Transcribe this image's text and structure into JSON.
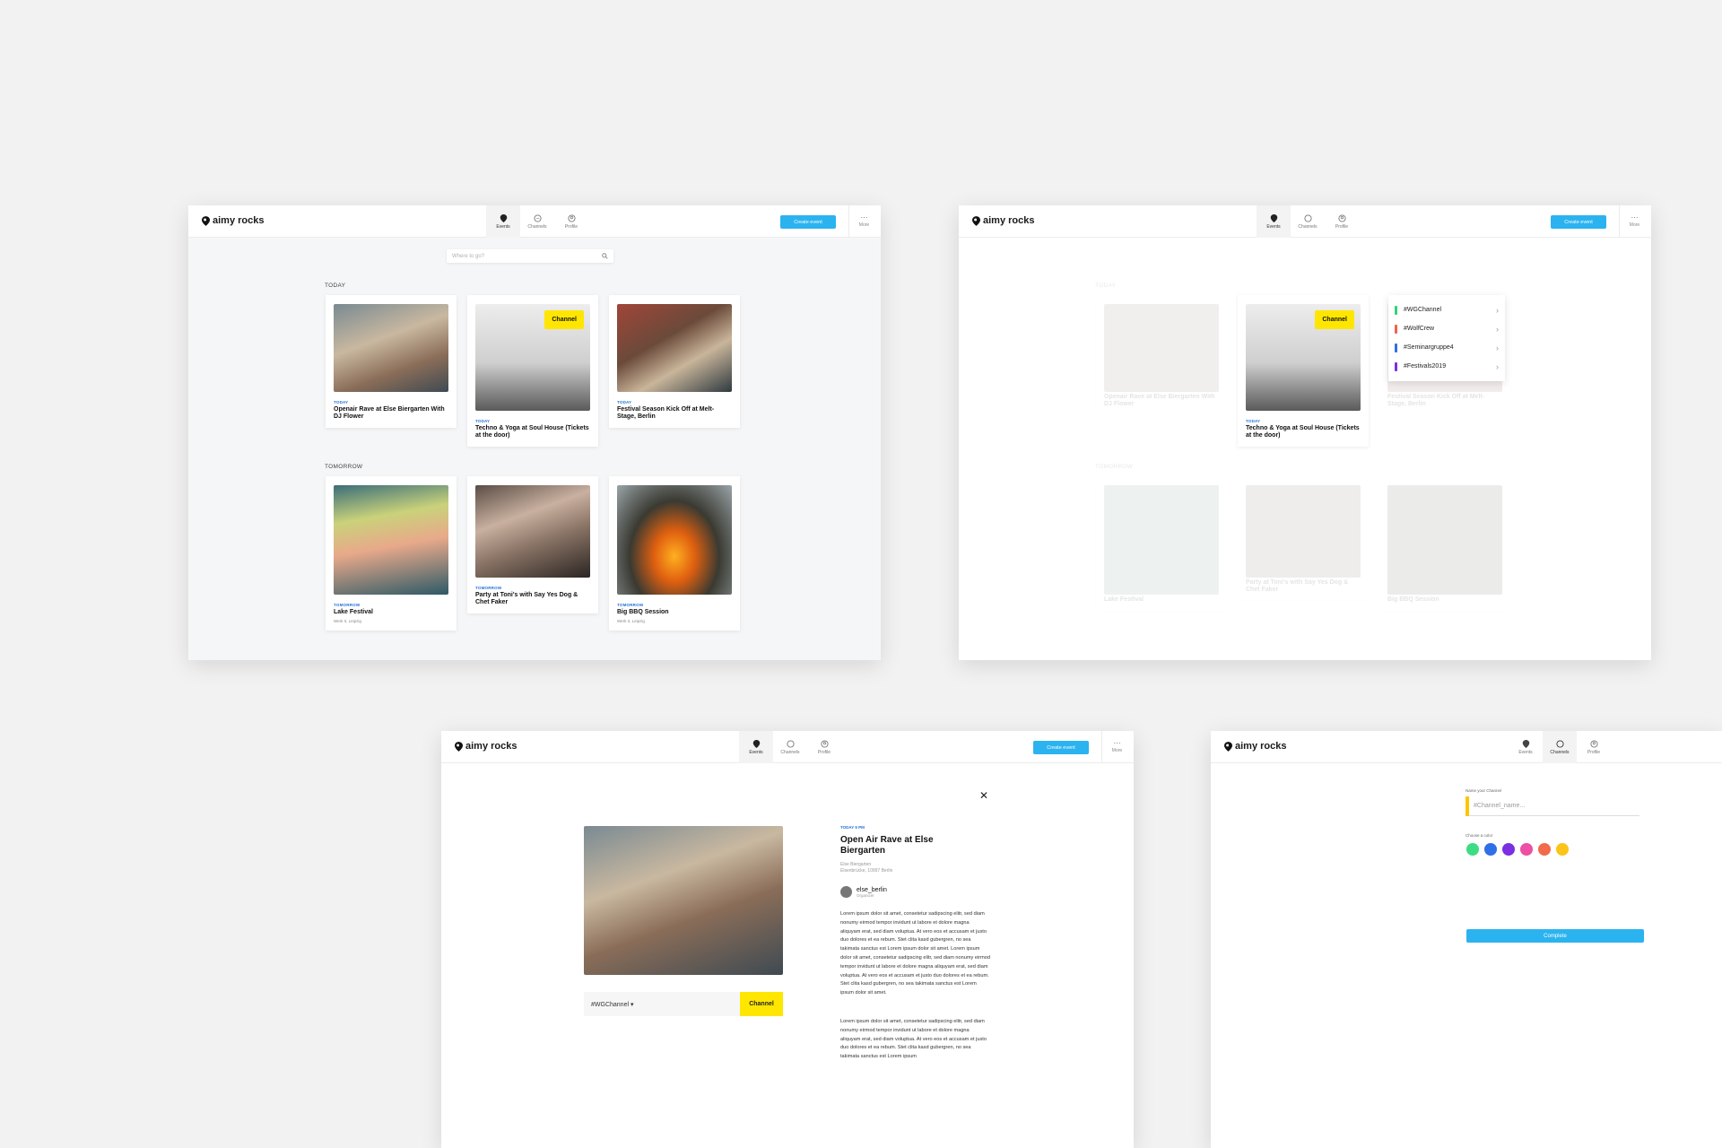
{
  "app": {
    "brand": "aimy rocks",
    "nav": {
      "events": "Events",
      "channels": "Channels",
      "profile": "Profile"
    },
    "create_event": "Create event",
    "more": "More"
  },
  "events_screen": {
    "search_placeholder": "Where to go?",
    "today_label": "TODAY",
    "tomorrow_label": "TOMORROW",
    "today_cards": [
      {
        "day": "TODAY",
        "title": "Openair Rave at Else Biergarten With DJ Flower"
      },
      {
        "day": "TODAY",
        "title": "Techno & Yoga at Soul House (Tickets at the door)",
        "badge": "Channel"
      },
      {
        "day": "TODAY",
        "title": "Festival Season Kick Off at Melt-Stage, Berlin"
      }
    ],
    "tomorrow_cards": [
      {
        "day": "TOMORROW",
        "title": "Lake Festival",
        "location": "Werk II, Leipzig"
      },
      {
        "day": "TOMORROW",
        "title": "Party at Toni's with Say Yes Dog & Chet Faker"
      },
      {
        "day": "TOMORROW",
        "title": "Big BBQ Session",
        "location": "Werk II, Leipzig"
      }
    ]
  },
  "channel_picker": {
    "items": [
      {
        "label": "#WGChannel",
        "color": "#2ed47a"
      },
      {
        "label": "#WolfCrew",
        "color": "#f0614f"
      },
      {
        "label": "#Seminargruppe4",
        "color": "#2f6fe8"
      },
      {
        "label": "#Festivals2019",
        "color": "#7b2fe0"
      }
    ]
  },
  "detail": {
    "time": "TODAY 5 PM",
    "title": "Open Air Rave at Else Biergarten",
    "place_line1": "Else Biergarten",
    "place_line2": "Elsenbrücke, 10997 Berlin",
    "organizer": "else_berlin",
    "organizer_role": "Organizer",
    "body1": "Lorem ipsum dolor sit amet, consetetur sadipscing elitr, sed diam nonumy eirmod tempor invidunt ut labore et dolore magna aliquyam erat, sed diam voluptua. At vero eos et accusam et justo duo dolores et ea rebum. Stet clita kasd gubergren, no sea takimata sanctus est Lorem ipsum dolor sit amet. Lorem ipsum dolor sit amet, consetetur sadipscing elitr, sed diam nonumy eirmod tempor invidunt ut labore et dolore magna aliquyam erat, sed diam voluptua. At vero eos et accusam et justo duo dolores et ea rebum. Stet clita kasd gubergren, no sea takimata sanctus est Lorem ipsum dolor sit amet.",
    "body2": "Lorem ipsum dolor sit amet, consetetur sadipscing elitr, sed diam nonumy eirmod tempor invidunt ut labore et dolore magna aliquyam erat, sed diam voluptua. At vero eos et accusam et justo duo dolores et ea rebum. Stet clita kasd gubergren, no sea takimata sanctus est Lorem ipsum",
    "channel_select": "#WGChannel",
    "channel_button": "Channel"
  },
  "new_channel": {
    "name_label": "Name your Channel",
    "name_placeholder": "#Channel_name...",
    "color_label": "Choose a color",
    "colors": [
      "#3ddc84",
      "#2f6fe8",
      "#7b2fe0",
      "#ec4fa3",
      "#f26a4b",
      "#fcc419"
    ],
    "complete": "Complete"
  }
}
